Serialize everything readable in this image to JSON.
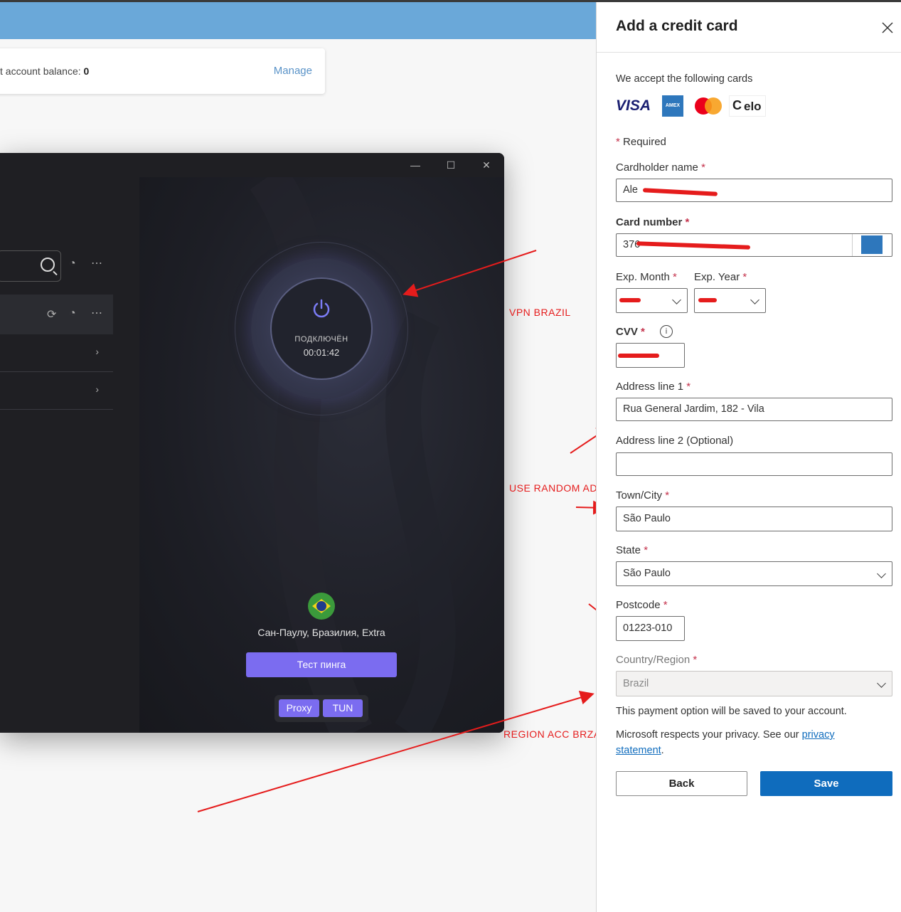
{
  "background": {
    "balance_label": "t account balance: ",
    "balance_value": "0",
    "manage_link": "Manage"
  },
  "vpn_app": {
    "status": "ПОДКЛЮЧЁН",
    "timer": "00:01:42",
    "location": "Сан-Паулу, Бразилия, Extra",
    "ping_button": "Тест пинга",
    "mode_proxy": "Proxy",
    "mode_tun": "TUN"
  },
  "annotations": {
    "vpn_brazil": "VPN BRAZIL",
    "use_random_address": "USE RANDOM ADREES",
    "region_acc": "REGION ACC BRZAIL"
  },
  "panel": {
    "title": "Add a credit card",
    "accepted_cards_label": "We accept the following cards",
    "cards": [
      "VISA",
      "AMEX",
      "Mastercard",
      "elo"
    ],
    "required_note": "Required",
    "cardholder_label": "Cardholder name",
    "cardholder_value": "Ale",
    "card_number_label": "Card number",
    "card_number_value": "376",
    "exp_month_label": "Exp. Month",
    "exp_year_label": "Exp. Year",
    "cvv_label": "CVV",
    "address1_label": "Address line 1",
    "address1_value": "Rua General Jardim, 182 - Vila",
    "address2_label": "Address line 2 (Optional)",
    "address2_value": "",
    "city_label": "Town/City",
    "city_value": "São Paulo",
    "state_label": "State",
    "state_value": "São Paulo",
    "postcode_label": "Postcode",
    "postcode_value": "01223-010",
    "country_label": "Country/Region",
    "country_value": "Brazil",
    "saved_note": "This payment option will be saved to your account.",
    "privacy_prefix": "Microsoft respects your privacy. See our ",
    "privacy_link_1": "privacy",
    "privacy_link_2": "statement",
    "privacy_suffix": ".",
    "back_button": "Back",
    "save_button": "Save"
  },
  "colors": {
    "accent": "#0f6cbd",
    "vpn_accent": "#7b6cf0",
    "annotation": "#e51c1c"
  }
}
